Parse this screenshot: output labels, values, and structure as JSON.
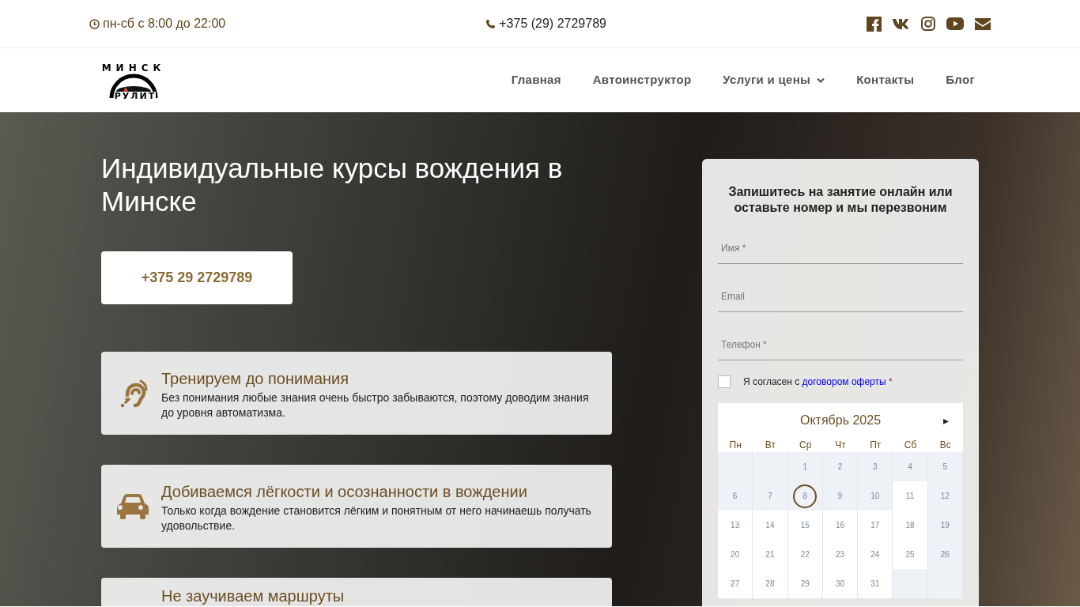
{
  "topbar": {
    "hours": "пн-сб с 8:00 до 22:00",
    "phone": "+375 (29) 2729789",
    "socials": [
      {
        "kind": "facebook"
      },
      {
        "kind": "vk"
      },
      {
        "kind": "instagram"
      },
      {
        "kind": "youtube"
      },
      {
        "kind": "email"
      }
    ]
  },
  "logo": {
    "top": "МИНСК",
    "bottom": "РУЛИТ"
  },
  "nav": [
    {
      "label": "Главная",
      "dropdown": false
    },
    {
      "label": "Автоинструктор",
      "dropdown": false
    },
    {
      "label": "Услуги и цены",
      "dropdown": true
    },
    {
      "label": "Контакты",
      "dropdown": false
    },
    {
      "label": "Блог",
      "dropdown": false
    }
  ],
  "hero": {
    "title": "Индивидуальные курсы вождения в Минске",
    "phone_button": "+375 29 2729789"
  },
  "features": [
    {
      "kind": "ear",
      "title": "Тренируем до понимания",
      "text": "Без понимания любые знания очень быстро забываются, поэтому доводим знания до уровня автоматизма."
    },
    {
      "kind": "car",
      "title": "Добиваемся лёгкости и осознанности в вождении",
      "text": "Только когда вождение становится лёгким и понятным от него начинаешь получать удовольствие."
    },
    {
      "kind": "none",
      "title": "Не заучиваем маршруты"
    }
  ],
  "form": {
    "title": "Запишитесь на занятие онлайн или оставьте номер и мы перезвоним",
    "fields": [
      {
        "placeholder": "Имя *"
      },
      {
        "placeholder": "Email"
      },
      {
        "placeholder": "Телефон *"
      }
    ],
    "consent": {
      "checked": false,
      "text": "Я согласен с",
      "link": "договором оферты",
      "required": "*"
    },
    "calendar": {
      "month": "Октябрь 2025",
      "next": "▸",
      "weekdays": [
        "Пн",
        "Вт",
        "Ср",
        "Чт",
        "Пт",
        "Сб",
        "Вс"
      ],
      "weeks": [
        [
          {
            "kind": "empty"
          },
          {
            "kind": "empty"
          },
          {
            "kind": "day",
            "day": "1",
            "available": false,
            "selected": false
          },
          {
            "kind": "day",
            "day": "2",
            "available": false,
            "selected": false
          },
          {
            "kind": "day",
            "day": "3",
            "available": false,
            "selected": false
          },
          {
            "kind": "day",
            "day": "4",
            "available": false,
            "selected": false
          },
          {
            "kind": "day",
            "day": "5",
            "available": false,
            "selected": false
          }
        ],
        [
          {
            "kind": "day",
            "day": "6",
            "available": false,
            "selected": false
          },
          {
            "kind": "day",
            "day": "7",
            "available": false,
            "selected": false
          },
          {
            "kind": "day",
            "day": "8",
            "available": false,
            "selected": true
          },
          {
            "kind": "day",
            "day": "9",
            "available": false,
            "selected": false
          },
          {
            "kind": "day",
            "day": "10",
            "available": false,
            "selected": false
          },
          {
            "kind": "day",
            "day": "11",
            "available": true,
            "selected": false
          },
          {
            "kind": "day",
            "day": "12",
            "available": false,
            "selected": false
          }
        ],
        [
          {
            "kind": "day",
            "day": "13",
            "available": true,
            "selected": false
          },
          {
            "kind": "day",
            "day": "14",
            "available": true,
            "selected": false
          },
          {
            "kind": "day",
            "day": "15",
            "available": true,
            "selected": false
          },
          {
            "kind": "day",
            "day": "16",
            "available": true,
            "selected": false
          },
          {
            "kind": "day",
            "day": "17",
            "available": true,
            "selected": false
          },
          {
            "kind": "day",
            "day": "18",
            "available": true,
            "selected": false
          },
          {
            "kind": "day",
            "day": "19",
            "available": false,
            "selected": false
          }
        ],
        [
          {
            "kind": "day",
            "day": "20",
            "available": true,
            "selected": false
          },
          {
            "kind": "day",
            "day": "21",
            "available": true,
            "selected": false
          },
          {
            "kind": "day",
            "day": "22",
            "available": true,
            "selected": false
          },
          {
            "kind": "day",
            "day": "23",
            "available": true,
            "selected": false
          },
          {
            "kind": "day",
            "day": "24",
            "available": true,
            "selected": false
          },
          {
            "kind": "day",
            "day": "25",
            "available": true,
            "selected": false
          },
          {
            "kind": "day",
            "day": "26",
            "available": false,
            "selected": false
          }
        ],
        [
          {
            "kind": "day",
            "day": "27",
            "available": true,
            "selected": false
          },
          {
            "kind": "day",
            "day": "28",
            "available": true,
            "selected": false
          },
          {
            "kind": "day",
            "day": "29",
            "available": true,
            "selected": false
          },
          {
            "kind": "day",
            "day": "30",
            "available": true,
            "selected": false
          },
          {
            "kind": "day",
            "day": "31",
            "available": true,
            "selected": false
          },
          {
            "kind": "empty"
          },
          {
            "kind": "empty"
          }
        ]
      ]
    }
  }
}
